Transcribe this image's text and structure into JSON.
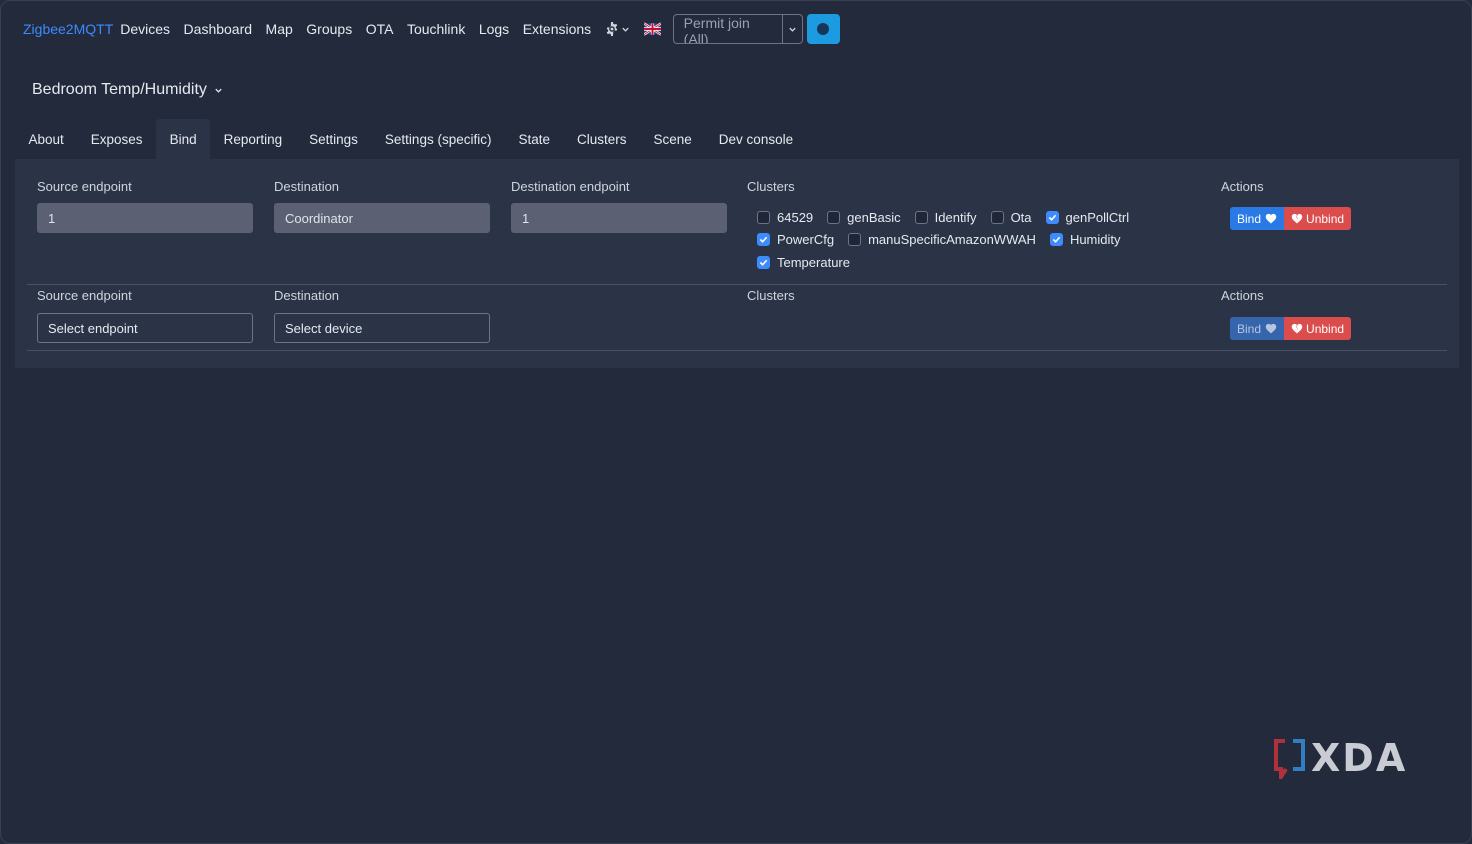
{
  "navbar": {
    "brand": "Zigbee2MQTT",
    "links": [
      "Devices",
      "Dashboard",
      "Map",
      "Groups",
      "OTA",
      "Touchlink",
      "Logs",
      "Extensions"
    ],
    "permit_join_label": "Permit join (All)"
  },
  "device": {
    "title": "Bedroom Temp/Humidity"
  },
  "tabs": [
    "About",
    "Exposes",
    "Bind",
    "Reporting",
    "Settings",
    "Settings (specific)",
    "State",
    "Clusters",
    "Scene",
    "Dev console"
  ],
  "active_tab": "Bind",
  "bind_rows": [
    {
      "labels": {
        "source_endpoint": "Source endpoint",
        "destination": "Destination",
        "destination_endpoint": "Destination endpoint",
        "clusters": "Clusters",
        "actions": "Actions"
      },
      "source_endpoint_value": "1",
      "destination_value": "Coordinator",
      "destination_endpoint_value": "1",
      "clusters": [
        [
          {
            "name": "64529",
            "checked": false
          },
          {
            "name": "genBasic",
            "checked": false
          },
          {
            "name": "Identify",
            "checked": false
          },
          {
            "name": "Ota",
            "checked": false
          },
          {
            "name": "genPollCtrl",
            "checked": true
          }
        ],
        [
          {
            "name": "PowerCfg",
            "checked": true
          },
          {
            "name": "manuSpecificAmazonWWAH",
            "checked": false
          },
          {
            "name": "Humidity",
            "checked": true
          }
        ],
        [
          {
            "name": "Temperature",
            "checked": true
          }
        ]
      ],
      "bind_label": "Bind",
      "unbind_label": "Unbind"
    },
    {
      "labels": {
        "source_endpoint": "Source endpoint",
        "destination": "Destination",
        "clusters": "Clusters",
        "actions": "Actions"
      },
      "source_endpoint_placeholder": "Select endpoint",
      "destination_placeholder": "Select device",
      "bind_label": "Bind",
      "unbind_label": "Unbind"
    }
  ],
  "watermark": "XDA",
  "colors": {
    "background": "#222a3c",
    "card": "#2b3347",
    "brand": "#3d8bfd",
    "bind": "#2a7ae6",
    "unbind": "#db4c4c",
    "light_button": "#1d9be0"
  }
}
